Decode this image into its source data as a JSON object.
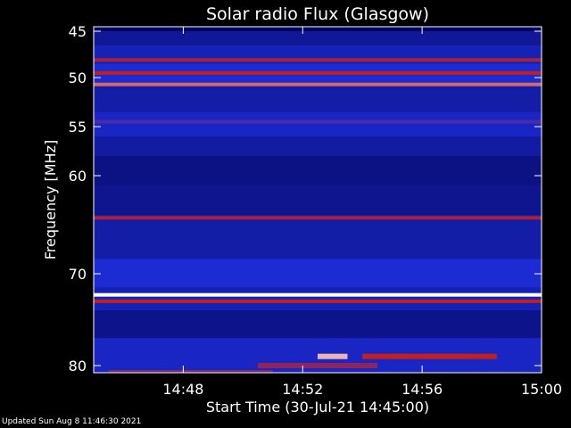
{
  "chart_data": {
    "type": "heatmap",
    "title": "Solar radio Flux (Glasgow)",
    "xlabel": "Start Time (30-Jul-21 14:45:00)",
    "ylabel": "Frequency [MHz]",
    "x_range_minutes": [
      0,
      15
    ],
    "xticks": [
      {
        "label": "14:48",
        "minute": 3
      },
      {
        "label": "14:52",
        "minute": 7
      },
      {
        "label": "14:56",
        "minute": 11
      },
      {
        "label": "15:00",
        "minute": 15
      }
    ],
    "y_range_mhz": [
      45,
      80
    ],
    "yticks": [
      {
        "label": "45",
        "mhz": 45
      },
      {
        "label": "50",
        "mhz": 50
      },
      {
        "label": "55",
        "mhz": 55
      },
      {
        "label": "60",
        "mhz": 60
      },
      {
        "label": "70",
        "mhz": 70
      },
      {
        "label": "80",
        "mhz": 80
      }
    ],
    "colormap": {
      "low": "#000050",
      "mid": "#2030e0",
      "high": "#c02020",
      "peak": "#ffffff"
    },
    "background_bands": [
      {
        "mhz_from": 45.0,
        "mhz_to": 46.5,
        "level": 0.25
      },
      {
        "mhz_from": 46.5,
        "mhz_to": 48.5,
        "level": 0.35
      },
      {
        "mhz_from": 48.5,
        "mhz_to": 50.5,
        "level": 0.45
      },
      {
        "mhz_from": 50.5,
        "mhz_to": 53.5,
        "level": 0.3
      },
      {
        "mhz_from": 53.5,
        "mhz_to": 56.0,
        "level": 0.4
      },
      {
        "mhz_from": 56.0,
        "mhz_to": 58.0,
        "level": 0.28
      },
      {
        "mhz_from": 58.0,
        "mhz_to": 61.0,
        "level": 0.18
      },
      {
        "mhz_from": 61.0,
        "mhz_to": 64.0,
        "level": 0.22
      },
      {
        "mhz_from": 64.0,
        "mhz_to": 68.5,
        "level": 0.3
      },
      {
        "mhz_from": 68.5,
        "mhz_to": 71.5,
        "level": 0.45
      },
      {
        "mhz_from": 71.5,
        "mhz_to": 74.0,
        "level": 0.35
      },
      {
        "mhz_from": 74.0,
        "mhz_to": 77.0,
        "level": 0.2
      },
      {
        "mhz_from": 77.0,
        "mhz_to": 80.5,
        "level": 0.4
      }
    ],
    "emission_lines": [
      {
        "mhz": 48.1,
        "intensity": 0.8
      },
      {
        "mhz": 49.5,
        "intensity": 0.85
      },
      {
        "mhz": 50.7,
        "intensity": 0.9
      },
      {
        "mhz": 54.5,
        "intensity": 0.6
      },
      {
        "mhz": 64.3,
        "intensity": 0.8
      },
      {
        "mhz": 72.3,
        "intensity": 1.0
      },
      {
        "mhz": 73.0,
        "intensity": 0.85
      }
    ],
    "bursts": [
      {
        "minute_from": 9.0,
        "minute_to": 13.5,
        "mhz": 79.0,
        "intensity": 0.85
      },
      {
        "minute_from": 5.5,
        "minute_to": 9.5,
        "mhz": 80.0,
        "intensity": 0.75
      },
      {
        "minute_from": 0.5,
        "minute_to": 6.0,
        "mhz": 80.5,
        "intensity": 0.7
      },
      {
        "minute_from": 7.5,
        "minute_to": 8.5,
        "mhz": 79.0,
        "intensity": 0.95
      }
    ]
  },
  "footer": {
    "updated_text": "Updated Sun Aug  8 11:46:30 2021"
  }
}
